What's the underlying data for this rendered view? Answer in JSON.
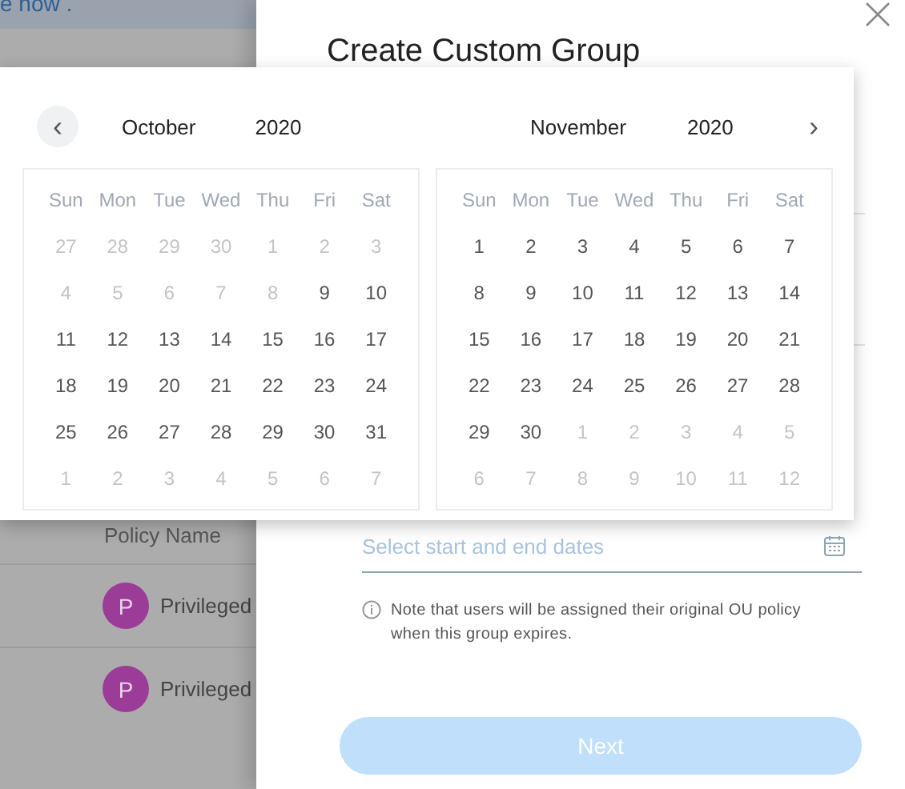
{
  "background": {
    "top_text": "e now .",
    "column_header": "Policy Name",
    "rows": [
      {
        "avatar": "P",
        "name": "Privileged",
        "color": "#9b3d98"
      },
      {
        "avatar": "P",
        "name": "Privileged",
        "color": "#9b3d98"
      }
    ]
  },
  "modal": {
    "title": "Create Custom Group",
    "date_field": {
      "placeholder": "Select start and end dates"
    },
    "note": "Note that users will be assigned their original OU policy when this group expires.",
    "next_button": {
      "label": "Next",
      "disabled": true
    }
  },
  "date_picker": {
    "prev": "‹",
    "next": "›",
    "months": [
      {
        "month": "October",
        "year": "2020",
        "weekdays": [
          "Sun",
          "Mon",
          "Tue",
          "Wed",
          "Thu",
          "Fri",
          "Sat"
        ],
        "days": [
          {
            "label": "27",
            "muted": true
          },
          {
            "label": "28",
            "muted": true
          },
          {
            "label": "29",
            "muted": true
          },
          {
            "label": "30",
            "muted": true
          },
          {
            "label": "1",
            "muted": true
          },
          {
            "label": "2",
            "muted": true
          },
          {
            "label": "3",
            "muted": true
          },
          {
            "label": "4",
            "muted": true
          },
          {
            "label": "5",
            "muted": true
          },
          {
            "label": "6",
            "muted": true
          },
          {
            "label": "7",
            "muted": true
          },
          {
            "label": "8",
            "muted": true
          },
          {
            "label": "9",
            "muted": false
          },
          {
            "label": "10",
            "muted": false
          },
          {
            "label": "11",
            "muted": false
          },
          {
            "label": "12",
            "muted": false
          },
          {
            "label": "13",
            "muted": false
          },
          {
            "label": "14",
            "muted": false
          },
          {
            "label": "15",
            "muted": false
          },
          {
            "label": "16",
            "muted": false
          },
          {
            "label": "17",
            "muted": false
          },
          {
            "label": "18",
            "muted": false
          },
          {
            "label": "19",
            "muted": false
          },
          {
            "label": "20",
            "muted": false
          },
          {
            "label": "21",
            "muted": false
          },
          {
            "label": "22",
            "muted": false
          },
          {
            "label": "23",
            "muted": false
          },
          {
            "label": "24",
            "muted": false
          },
          {
            "label": "25",
            "muted": false
          },
          {
            "label": "26",
            "muted": false
          },
          {
            "label": "27",
            "muted": false
          },
          {
            "label": "28",
            "muted": false
          },
          {
            "label": "29",
            "muted": false
          },
          {
            "label": "30",
            "muted": false
          },
          {
            "label": "31",
            "muted": false
          },
          {
            "label": "1",
            "muted": true
          },
          {
            "label": "2",
            "muted": true
          },
          {
            "label": "3",
            "muted": true
          },
          {
            "label": "4",
            "muted": true
          },
          {
            "label": "5",
            "muted": true
          },
          {
            "label": "6",
            "muted": true
          },
          {
            "label": "7",
            "muted": true
          }
        ]
      },
      {
        "month": "November",
        "year": "2020",
        "weekdays": [
          "Sun",
          "Mon",
          "Tue",
          "Wed",
          "Thu",
          "Fri",
          "Sat"
        ],
        "days": [
          {
            "label": "1",
            "muted": false
          },
          {
            "label": "2",
            "muted": false
          },
          {
            "label": "3",
            "muted": false
          },
          {
            "label": "4",
            "muted": false
          },
          {
            "label": "5",
            "muted": false
          },
          {
            "label": "6",
            "muted": false
          },
          {
            "label": "7",
            "muted": false
          },
          {
            "label": "8",
            "muted": false
          },
          {
            "label": "9",
            "muted": false
          },
          {
            "label": "10",
            "muted": false
          },
          {
            "label": "11",
            "muted": false
          },
          {
            "label": "12",
            "muted": false
          },
          {
            "label": "13",
            "muted": false
          },
          {
            "label": "14",
            "muted": false
          },
          {
            "label": "15",
            "muted": false
          },
          {
            "label": "16",
            "muted": false
          },
          {
            "label": "17",
            "muted": false
          },
          {
            "label": "18",
            "muted": false
          },
          {
            "label": "19",
            "muted": false
          },
          {
            "label": "20",
            "muted": false
          },
          {
            "label": "21",
            "muted": false
          },
          {
            "label": "22",
            "muted": false
          },
          {
            "label": "23",
            "muted": false
          },
          {
            "label": "24",
            "muted": false
          },
          {
            "label": "25",
            "muted": false
          },
          {
            "label": "26",
            "muted": false
          },
          {
            "label": "27",
            "muted": false
          },
          {
            "label": "28",
            "muted": false
          },
          {
            "label": "29",
            "muted": false
          },
          {
            "label": "30",
            "muted": false
          },
          {
            "label": "1",
            "muted": true
          },
          {
            "label": "2",
            "muted": true
          },
          {
            "label": "3",
            "muted": true
          },
          {
            "label": "4",
            "muted": true
          },
          {
            "label": "5",
            "muted": true
          },
          {
            "label": "6",
            "muted": true
          },
          {
            "label": "7",
            "muted": true
          },
          {
            "label": "8",
            "muted": true
          },
          {
            "label": "9",
            "muted": true
          },
          {
            "label": "10",
            "muted": true
          },
          {
            "label": "11",
            "muted": true
          },
          {
            "label": "12",
            "muted": true
          }
        ]
      }
    ]
  }
}
